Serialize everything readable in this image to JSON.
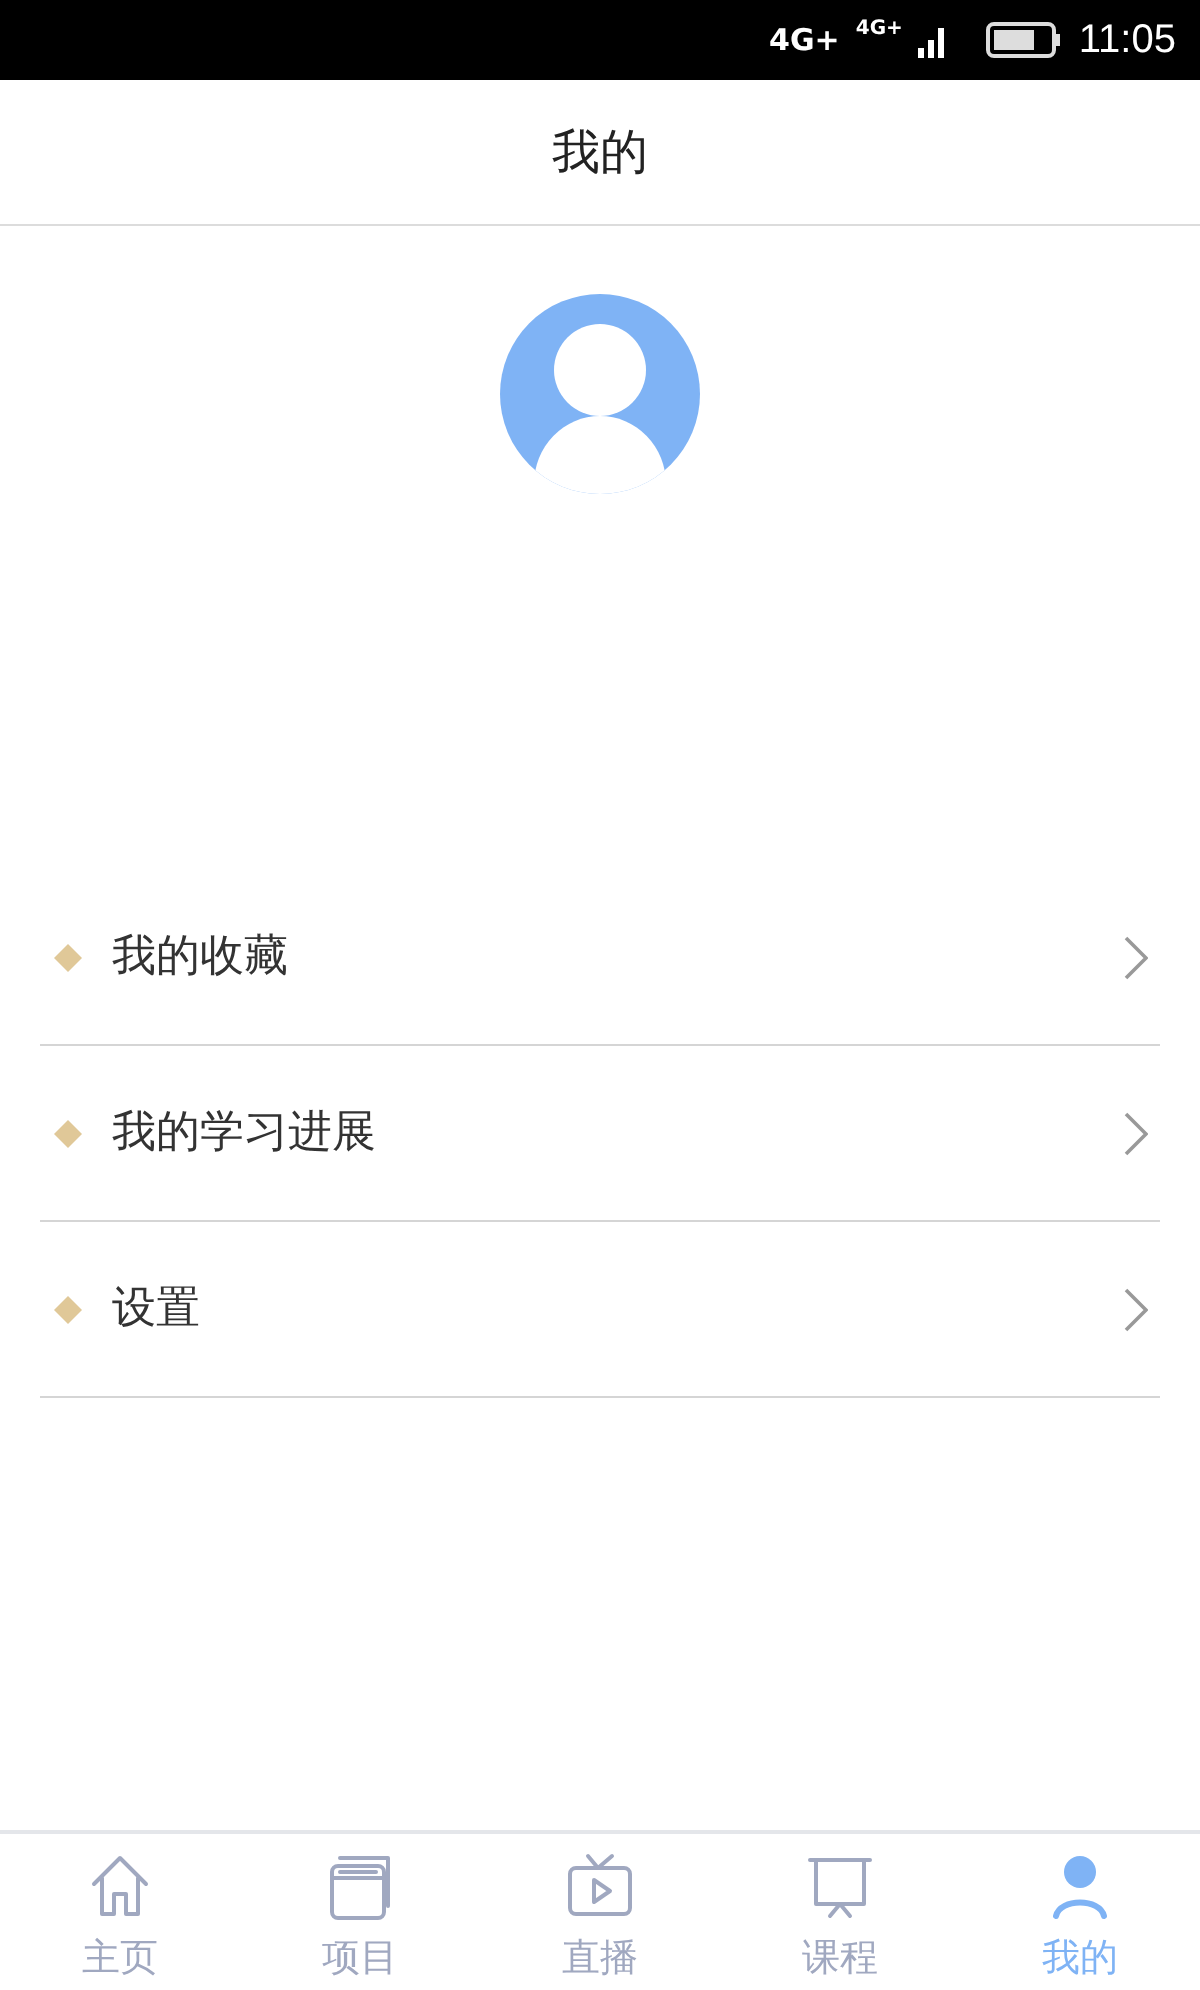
{
  "status_bar": {
    "network": "4G+",
    "network_2": "4G+",
    "time": "11:05"
  },
  "header": {
    "title": "我的"
  },
  "menu": [
    {
      "label": "我的收藏"
    },
    {
      "label": "我的学习进展"
    },
    {
      "label": "设置"
    }
  ],
  "tabs": [
    {
      "kind": "home",
      "label": "主页",
      "selected": false
    },
    {
      "kind": "project",
      "label": "项目",
      "selected": false
    },
    {
      "kind": "live",
      "label": "直播",
      "selected": false
    },
    {
      "kind": "course",
      "label": "课程",
      "selected": false
    },
    {
      "kind": "me",
      "label": "我的",
      "selected": true
    }
  ]
}
